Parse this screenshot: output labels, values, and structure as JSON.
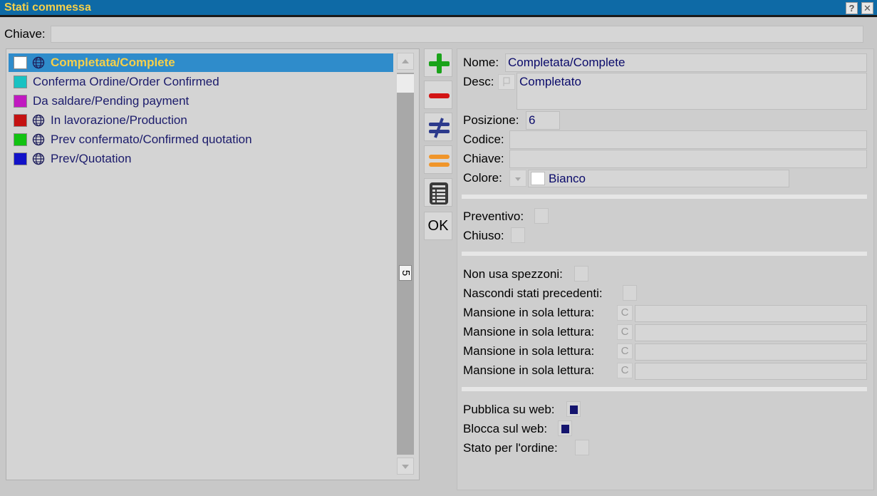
{
  "window": {
    "title": "Stati commessa",
    "help_label": "?",
    "close_label": "✕"
  },
  "search": {
    "label": "Chiave:",
    "value": ""
  },
  "list": {
    "items": [
      {
        "label": "Completata/Complete",
        "color": "#ffffff",
        "web": true,
        "selected": true
      },
      {
        "label": "Conferma Ordine/Order Confirmed",
        "color": "#19c2c2",
        "web": false,
        "selected": false
      },
      {
        "label": "Da saldare/Pending payment",
        "color": "#c019c0",
        "web": false,
        "selected": false
      },
      {
        "label": "In lavorazione/Production",
        "color": "#c41212",
        "web": true,
        "selected": false
      },
      {
        "label": "Prev confermato/Confirmed quotation",
        "color": "#12c212",
        "web": true,
        "selected": false
      },
      {
        "label": "Prev/Quotation",
        "color": "#1212c8",
        "web": true,
        "selected": false
      }
    ],
    "count": "5"
  },
  "toolbar": {
    "add": "add-icon",
    "remove": "remove-icon",
    "not_equal": "not-equal-icon",
    "equal": "equal-icon",
    "calculator": "calculator-icon",
    "ok_label": "OK"
  },
  "detail": {
    "nome_label": "Nome:",
    "nome_value": "Completata/Complete",
    "desc_label": "Desc:",
    "desc_value": "Completato",
    "posizione_label": "Posizione:",
    "posizione_value": "6",
    "codice_label": "Codice:",
    "codice_value": "",
    "chiave_label": "Chiave:",
    "chiave_value": "",
    "colore_label": "Colore:",
    "colore_value": "Bianco",
    "colore_swatch": "#ffffff",
    "preventivo_label": "Preventivo:",
    "preventivo_checked": false,
    "chiuso_label": "Chiuso:",
    "chiuso_checked": false,
    "non_usa_label": "Non usa spezzoni:",
    "non_usa_checked": false,
    "nascondi_label": "Nascondi stati precedenti:",
    "nascondi_checked": false,
    "mansioni": [
      {
        "label": "Mansione in sola lettura:",
        "button": "C",
        "value": ""
      },
      {
        "label": "Mansione in sola lettura:",
        "button": "C",
        "value": ""
      },
      {
        "label": "Mansione in sola lettura:",
        "button": "C",
        "value": ""
      },
      {
        "label": "Mansione in sola lettura:",
        "button": "C",
        "value": ""
      }
    ],
    "pubblica_label": "Pubblica su web:",
    "pubblica_checked": true,
    "blocca_label": "Blocca sul web:",
    "blocca_checked": true,
    "stato_ordine_label": "Stato per l'ordine:",
    "stato_ordine_checked": false
  },
  "colors": {
    "title_bar": "#0e6aa6",
    "title_text": "#f6d04a",
    "selection": "#2f8ccb",
    "field_text": "#0a0a6a"
  }
}
